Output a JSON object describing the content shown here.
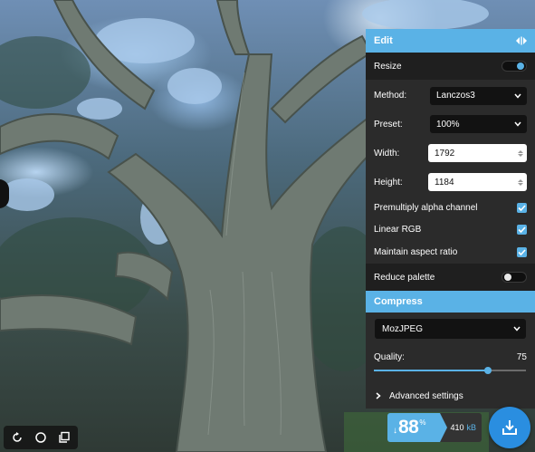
{
  "edit": {
    "title": "Edit",
    "resize": {
      "label": "Resize",
      "enabled": true
    },
    "method": {
      "label": "Method:",
      "value": "Lanczos3"
    },
    "preset": {
      "label": "Preset:",
      "value": "100%"
    },
    "width": {
      "label": "Width:",
      "value": "1792"
    },
    "height": {
      "label": "Height:",
      "value": "1184"
    },
    "premultiply": {
      "label": "Premultiply alpha channel",
      "checked": true
    },
    "linear_rgb": {
      "label": "Linear RGB",
      "checked": true
    },
    "aspect": {
      "label": "Maintain aspect ratio",
      "checked": true
    },
    "reduce_palette": {
      "label": "Reduce palette",
      "enabled": false
    }
  },
  "compress": {
    "title": "Compress",
    "codec": "MozJPEG",
    "quality": {
      "label": "Quality:",
      "value": "75",
      "fraction": 0.75
    },
    "advanced": "Advanced settings"
  },
  "result": {
    "percent": "88",
    "percent_unit": "%",
    "arrow": "↓",
    "size": "410",
    "size_unit": "kB"
  },
  "icons": {
    "toolbar": [
      "rotate-icon",
      "circle-icon",
      "copy-icon"
    ],
    "panel": [
      "swap-sides-icon",
      "chevron-down-icon",
      "check-icon",
      "chevron-right-icon"
    ],
    "download": "download-icon"
  },
  "colors": {
    "accent": "#5ab2e6",
    "panel_bg": "#2b2b2b",
    "download": "#2a8ee0"
  }
}
